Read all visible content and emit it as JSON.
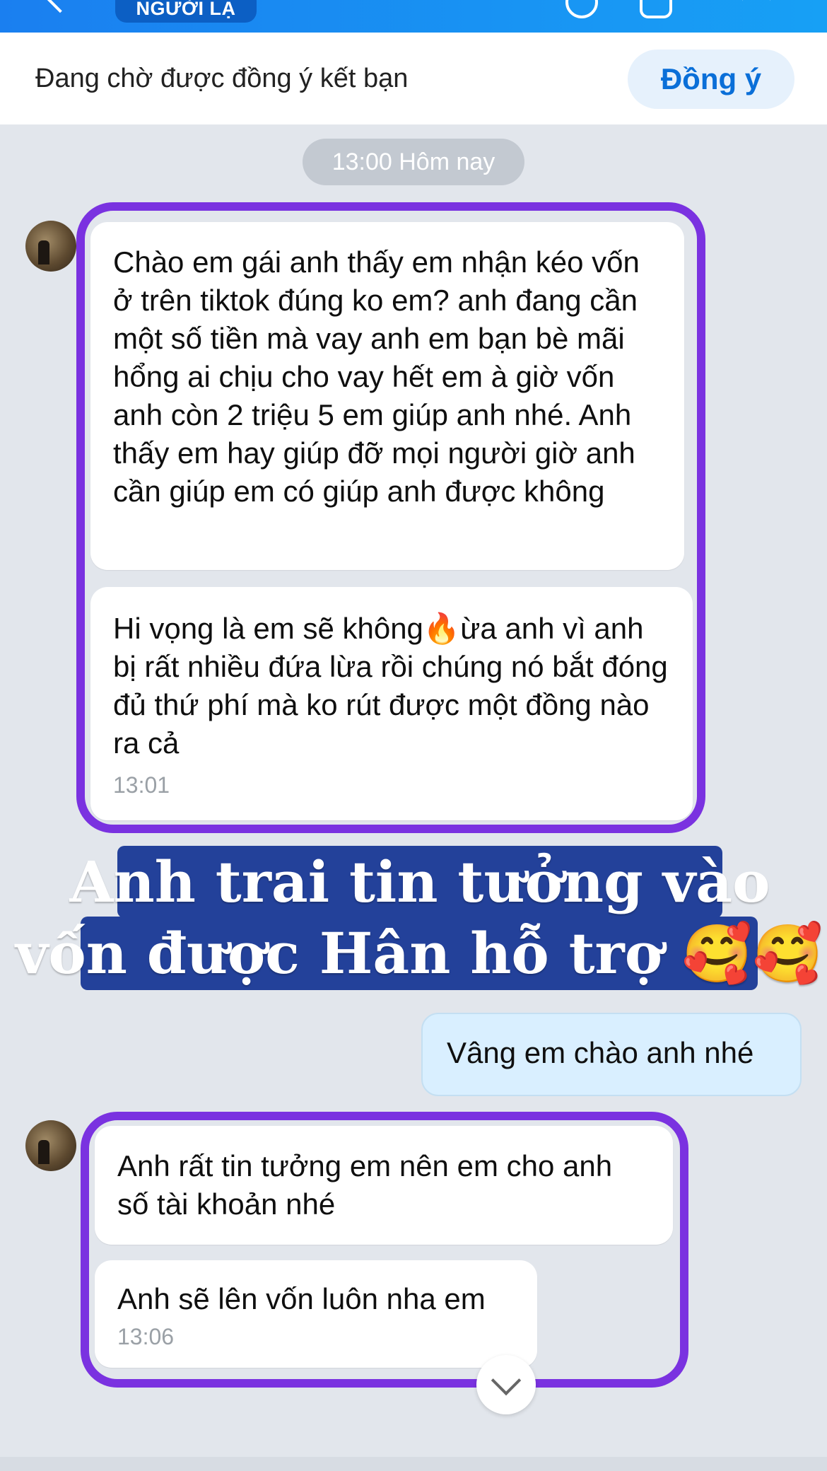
{
  "header": {
    "stranger_badge": "NGƯỜI LẠ"
  },
  "pending": {
    "text": "Đang chờ được đồng ý kết bạn",
    "agree_label": "Đồng ý"
  },
  "timestamp_pill": "13:00 Hôm nay",
  "messages": [
    {
      "text": "Chào em gái anh thấy em nhận kéo vốn ở trên tiktok đúng ko em? anh đang cần một số tiền mà vay anh em bạn bè mãi hổng ai chịu cho vay hết em à giờ vốn anh còn 2 triệu 5 em giúp anh nhé. Anh thấy em hay giúp đỡ mọi người giờ anh cần giúp em có giúp anh được không"
    },
    {
      "text": "Hi vọng là em sẽ không🔥ừa anh vì anh bị rất nhiều đứa lừa rồi chúng nó bắt đóng đủ thứ phí mà ko rút được một đồng nào ra cả",
      "time": "13:01"
    },
    {
      "text": "Vâng em chào anh nhé"
    },
    {
      "text": "Anh rất tin tưởng em nên em cho anh số tài khoản nhé"
    },
    {
      "text": "Anh sẽ lên vốn luôn nha em",
      "time": "13:06"
    }
  ],
  "caption": {
    "line1": "Anh trai tin tưởng vào",
    "line2": "vốn được Hân hỗ trợ 🥰🥰"
  },
  "colors": {
    "header_blue": "#1a7ff0",
    "highlight_purple": "#7a32e0",
    "caption_bg": "#23419a",
    "my_bubble": "#d9efff",
    "agree_text": "#0a6fd8"
  },
  "icons": [
    "back-arrow-icon",
    "phone-icon",
    "video-call-icon",
    "menu-icon",
    "chevron-down-icon"
  ]
}
